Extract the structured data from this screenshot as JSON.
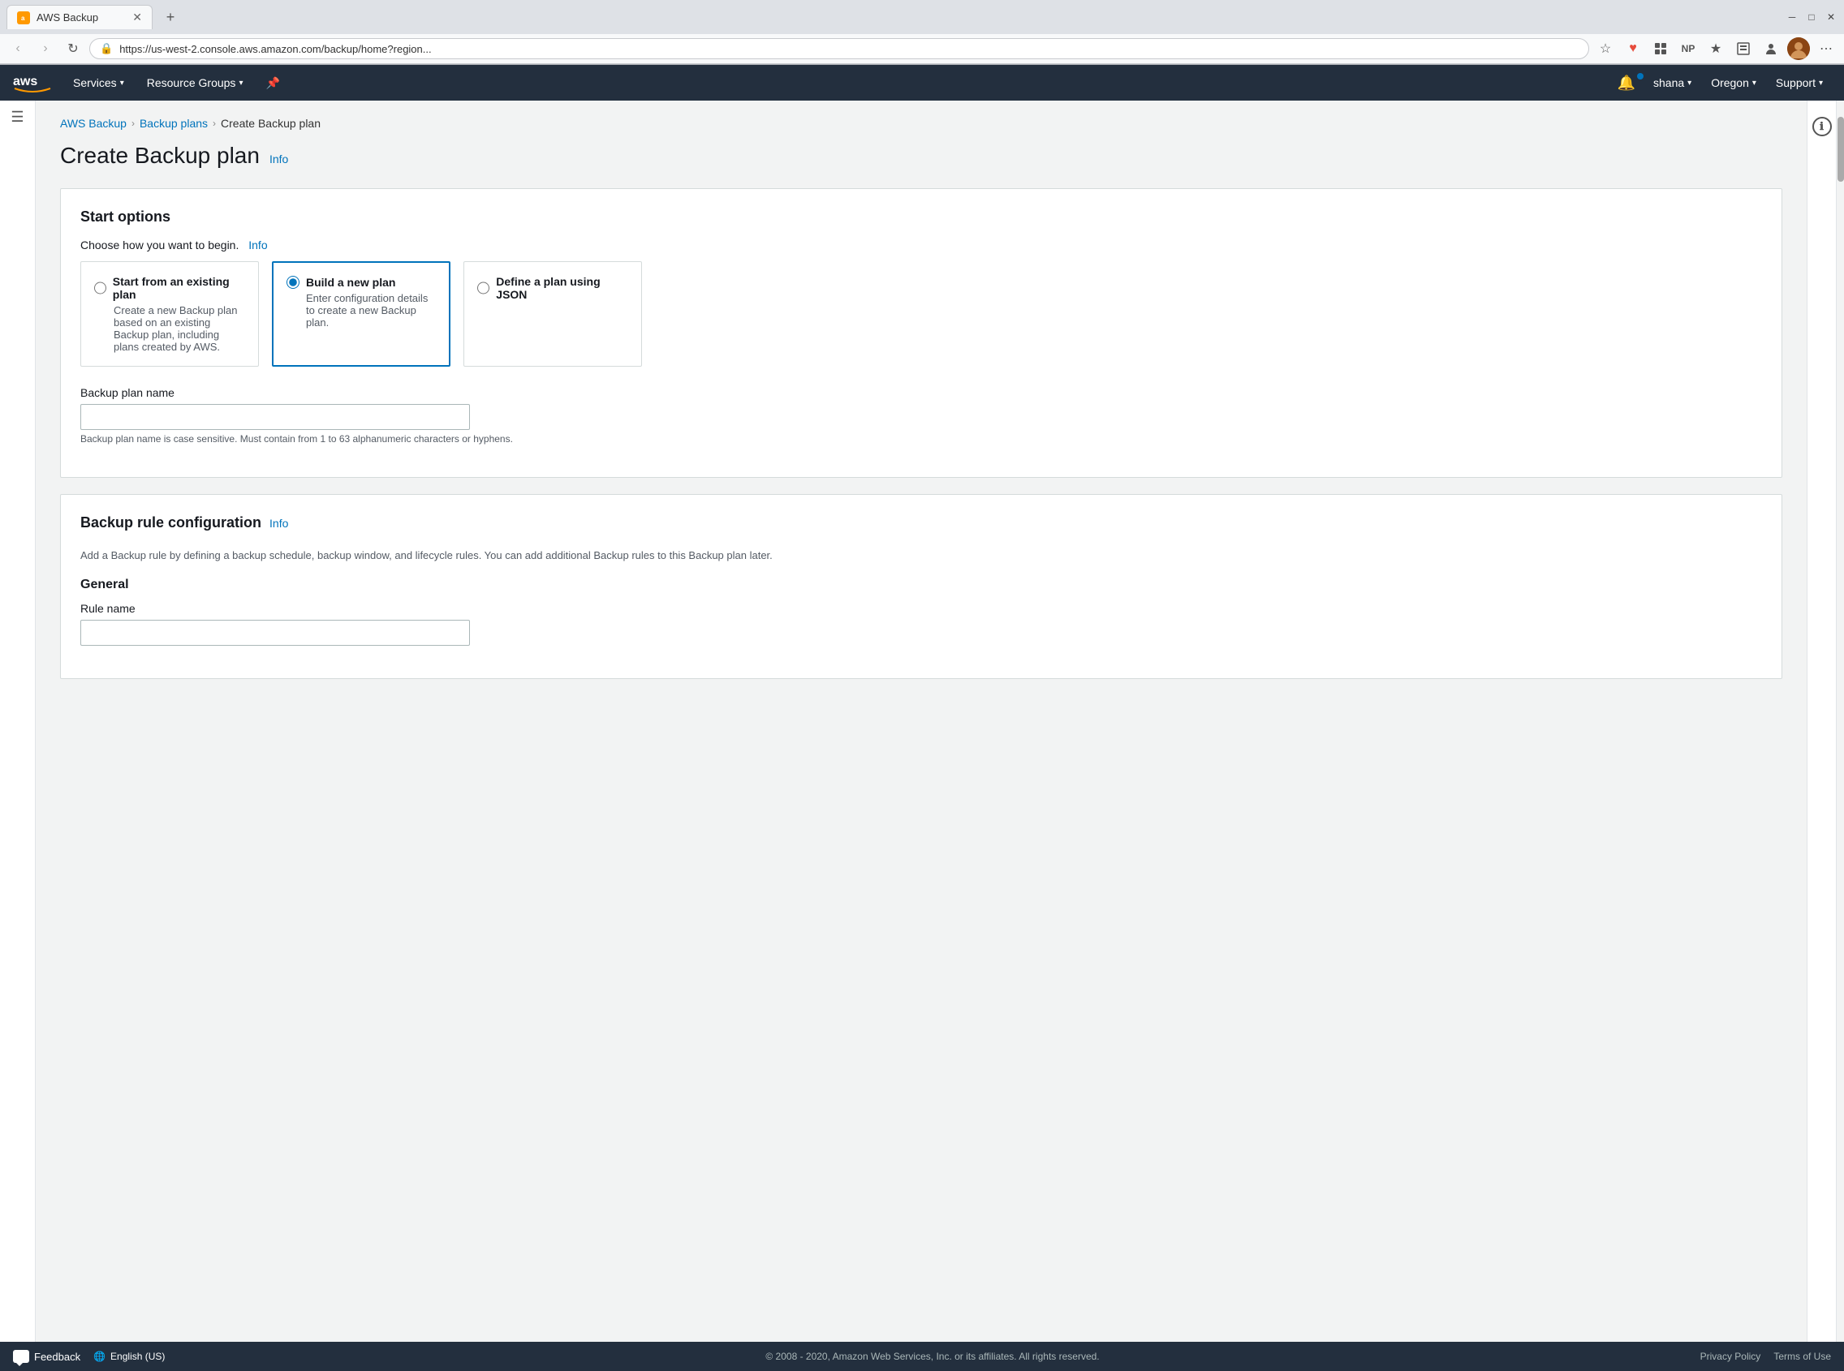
{
  "browser": {
    "tab_title": "AWS Backup",
    "url": "https://us-west-2.console.aws.amazon.com/backup/home?region...",
    "new_tab_label": "+",
    "back_disabled": false,
    "forward_disabled": true
  },
  "aws_nav": {
    "logo": "aws",
    "services_label": "Services",
    "resource_groups_label": "Resource Groups",
    "user_label": "shana",
    "region_label": "Oregon",
    "support_label": "Support"
  },
  "breadcrumb": {
    "items": [
      {
        "label": "AWS Backup",
        "link": true
      },
      {
        "label": "Backup plans",
        "link": true
      },
      {
        "label": "Create Backup plan",
        "link": false
      }
    ]
  },
  "page": {
    "title": "Create Backup plan",
    "info_label": "Info"
  },
  "start_options": {
    "section_title": "Start options",
    "choose_label": "Choose how you want to begin.",
    "info_label": "Info",
    "options": [
      {
        "id": "existing",
        "label": "Start from an existing plan",
        "description": "Create a new Backup plan based on an existing Backup plan, including plans created by AWS.",
        "selected": false
      },
      {
        "id": "new",
        "label": "Build a new plan",
        "description": "Enter configuration details to create a new Backup plan.",
        "selected": true
      },
      {
        "id": "json",
        "label": "Define a plan using JSON",
        "description": "",
        "selected": false
      }
    ],
    "plan_name_label": "Backup plan name",
    "plan_name_placeholder": "",
    "plan_name_hint": "Backup plan name is case sensitive. Must contain from 1 to 63 alphanumeric characters or hyphens."
  },
  "backup_rule": {
    "section_title": "Backup rule configuration",
    "info_label": "Info",
    "description": "Add a Backup rule by defining a backup schedule, backup window, and lifecycle rules. You can add additional Backup rules to this Backup plan later.",
    "general_title": "General",
    "rule_name_label": "Rule name",
    "rule_name_placeholder": ""
  },
  "footer": {
    "feedback_label": "Feedback",
    "language_label": "English (US)",
    "copyright": "© 2008 - 2020, Amazon Web Services, Inc. or its affiliates. All rights reserved.",
    "privacy_label": "Privacy Policy",
    "terms_label": "Terms of Use"
  }
}
